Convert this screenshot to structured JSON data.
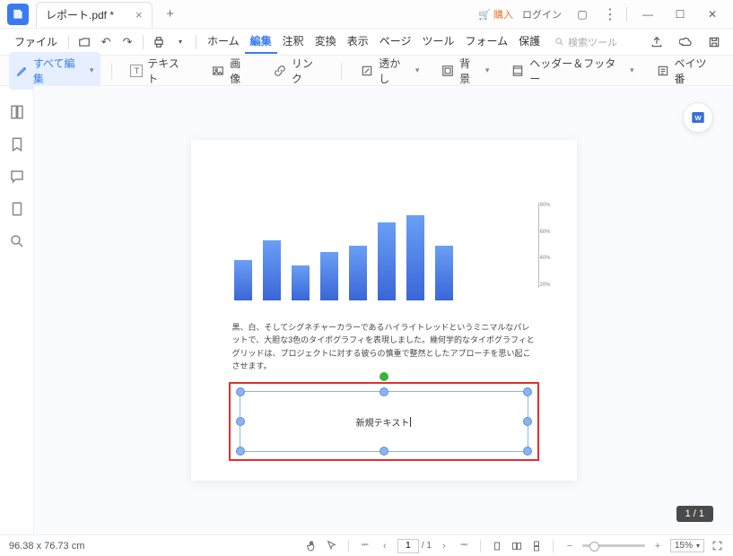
{
  "titlebar": {
    "filename": "レポート.pdf *",
    "buy": "購入",
    "login": "ログイン"
  },
  "menubar": {
    "file": "ファイル",
    "items": [
      "ホーム",
      "編集",
      "注釈",
      "変換",
      "表示",
      "ページ",
      "ツール",
      "フォーム",
      "保護"
    ],
    "active_index": 1,
    "search_placeholder": "検索ツール"
  },
  "toolbar": {
    "edit_all": "すべて編集",
    "text": "テキスト",
    "image": "画像",
    "link": "リンク",
    "watermark": "透かし",
    "background": "背景",
    "header_footer": "ヘッダー＆フッター",
    "bates": "ベイツ番"
  },
  "document": {
    "body_text": "黒、白、そしてシグネチャーカラーであるハイライトレッドというミニマルなパレットで、大胆な3色のタイポグラフィを表現しました。幾何学的なタイポグラフィとグリッドは、プロジェクトに対する彼らの慎重で整然としたアプローチを思い起こさせます。",
    "new_text": "新規テキスト"
  },
  "chart_data": {
    "type": "bar",
    "categories": [
      "",
      "",
      "",
      "",
      "",
      "",
      "",
      ""
    ],
    "values": [
      40,
      60,
      35,
      48,
      55,
      78,
      85,
      55
    ],
    "yticks": [
      "80%",
      "60%",
      "40%",
      "20%"
    ],
    "title": "",
    "xlabel": "",
    "ylabel": "",
    "ylim": [
      0,
      90
    ]
  },
  "page_indicator": "1 / 1",
  "status": {
    "coords": "96.38 x 76.73 cm",
    "page_current": "1",
    "page_total": "/ 1",
    "zoom": "15%"
  }
}
